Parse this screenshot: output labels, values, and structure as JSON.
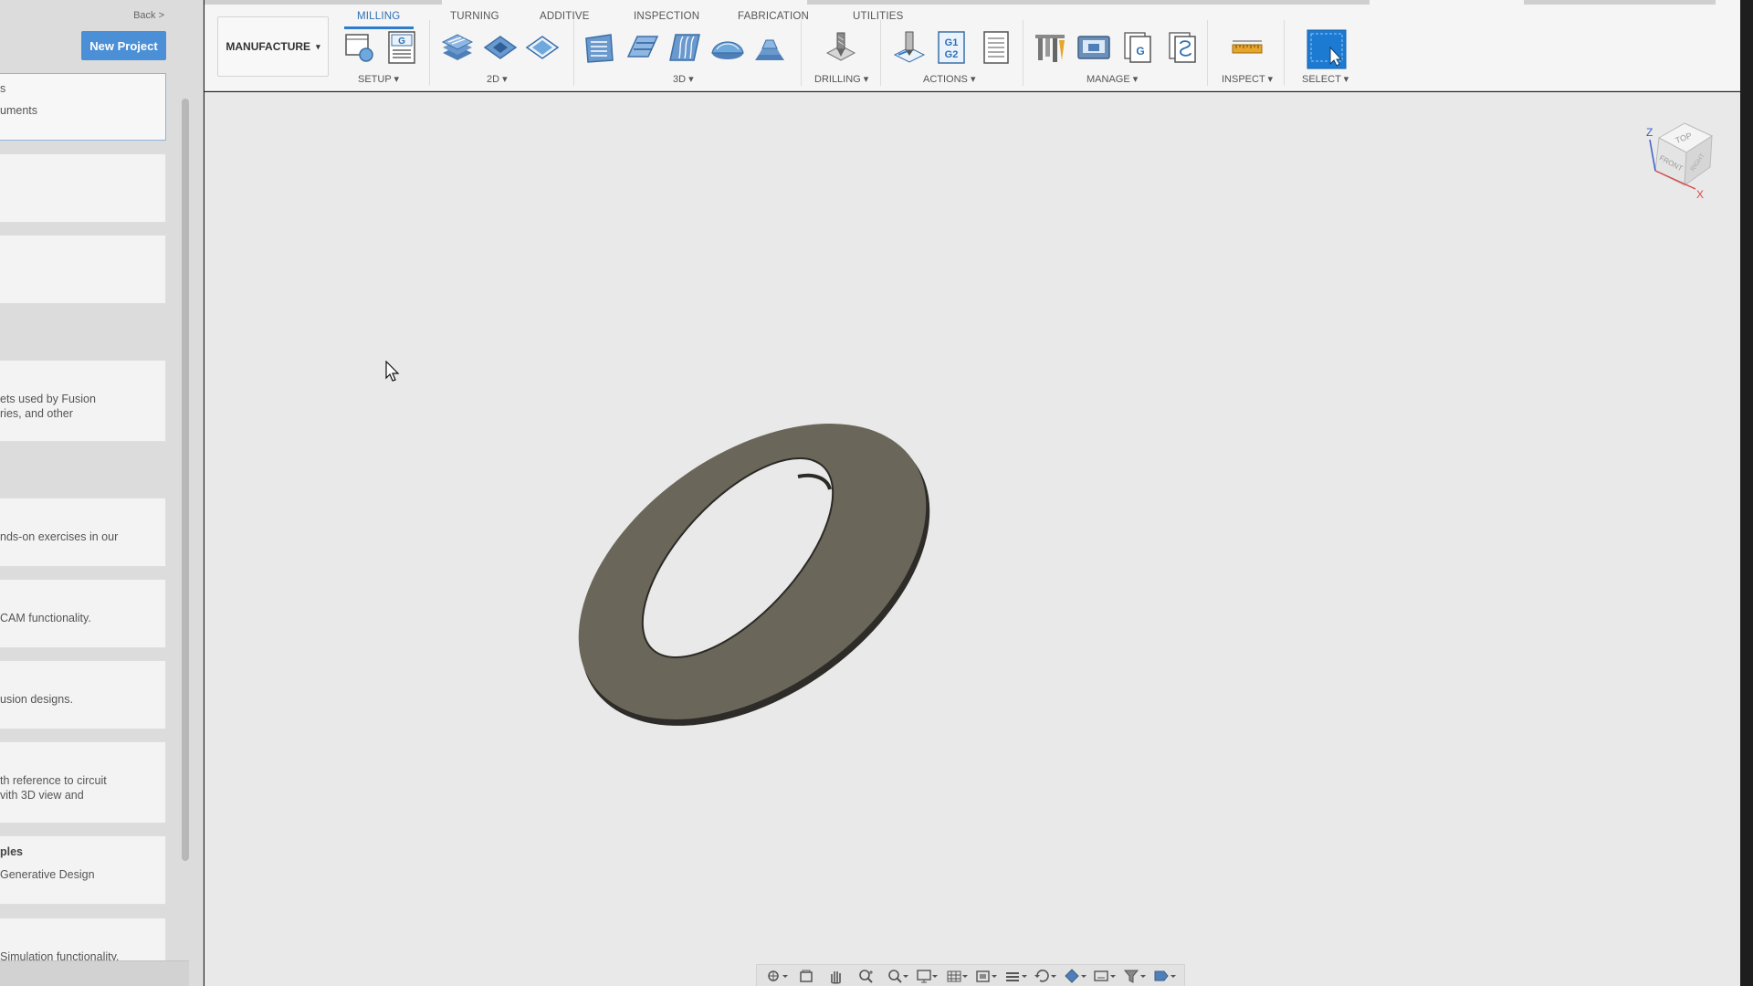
{
  "left_panel": {
    "back_label": "Back >",
    "new_project_label": "New Project",
    "cards": [
      {
        "lines": [
          "s",
          "uments"
        ]
      },
      {
        "lines": []
      },
      {
        "lines": []
      },
      {
        "lines": [
          "ets used by Fusion",
          "ries, and other"
        ]
      },
      {
        "lines": [
          "nds-on exercises in our"
        ]
      },
      {
        "lines": [
          "CAM functionality."
        ]
      },
      {
        "lines": [
          "usion designs."
        ]
      },
      {
        "lines": [
          "th reference to circuit",
          "vith 3D view and"
        ]
      },
      {
        "lines": [
          "ples",
          "Generative Design"
        ]
      },
      {
        "lines": [
          "Simulation functionality."
        ]
      }
    ]
  },
  "toolbar": {
    "workspace_label": "MANUFACTURE",
    "tabs": [
      {
        "label": "MILLING",
        "active": true
      },
      {
        "label": "TURNING",
        "active": false
      },
      {
        "label": "ADDITIVE",
        "active": false
      },
      {
        "label": "INSPECTION",
        "active": false
      },
      {
        "label": "FABRICATION",
        "active": false
      },
      {
        "label": "UTILITIES",
        "active": false
      }
    ],
    "groups": {
      "setup": "SETUP ▾",
      "two_d": "2D ▾",
      "three_d": "3D ▾",
      "drilling": "DRILLING ▾",
      "actions": "ACTIONS ▾",
      "manage": "MANAGE ▾",
      "inspect": "INSPECT ▾",
      "select": "SELECT ▾"
    },
    "icons": {
      "setup": [
        "setup-icon",
        "nc-program-icon"
      ],
      "two_d": [
        "2d-adaptive-icon",
        "2d-pocket-icon",
        "face-icon"
      ],
      "three_d": [
        "3d-adaptive-icon",
        "waterline-icon",
        "parallel-icon",
        "scallop-icon",
        "contour-icon"
      ],
      "drilling": [
        "drill-icon"
      ],
      "actions": [
        "simulate-icon",
        "post-process-icon",
        "setup-sheet-icon"
      ],
      "manage": [
        "tool-library-icon",
        "machine-library-icon",
        "post-library-icon",
        "template-library-icon"
      ],
      "inspect": [
        "measure-icon"
      ],
      "select": [
        "select-icon"
      ]
    },
    "accent": "#2e7cd0"
  },
  "viewcube": {
    "faces": {
      "top": "TOP",
      "front": "FRONT",
      "right": "RIGHT"
    },
    "axes": {
      "z": "Z",
      "x": "X"
    }
  },
  "model": {
    "part_color": "#6b665a",
    "description_icon": "oval-ring-part"
  },
  "navbar": {
    "tools": [
      "orbit-icon",
      "look-at-icon",
      "pan-icon",
      "zoom-icon",
      "zoom-window-icon",
      "display-settings-icon",
      "grid-icon",
      "viewports-icon",
      "sections-icon",
      "rotate-icon",
      "appearance-icon",
      "environment-icon",
      "filter-icon",
      "selection-icon"
    ]
  }
}
